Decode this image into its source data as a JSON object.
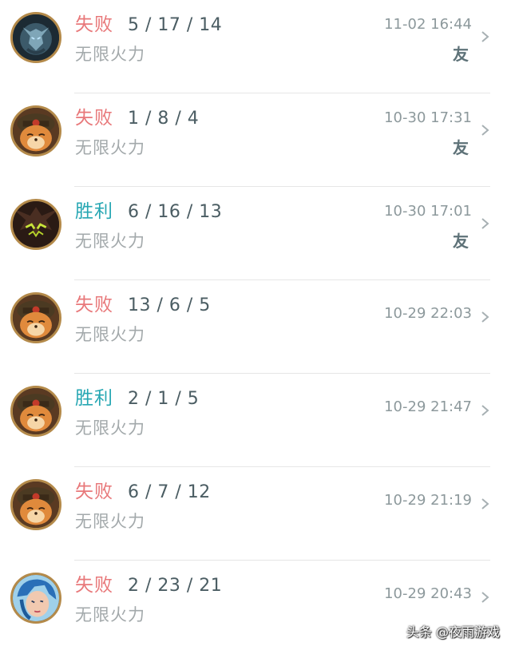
{
  "matches": [
    {
      "champion_icon": "dark-knight-champion-icon",
      "result": "失败",
      "outcome": "loss",
      "kda": "5 / 17 / 14",
      "mode": "无限火力",
      "time": "11-02 16:44",
      "badge": "友"
    },
    {
      "champion_icon": "teemo-champion-icon",
      "result": "失败",
      "outcome": "loss",
      "kda": "1 / 8 / 4",
      "mode": "无限火力",
      "time": "10-30 17:31",
      "badge": "友"
    },
    {
      "champion_icon": "shadow-beast-champion-icon",
      "result": "胜利",
      "outcome": "win",
      "kda": "6 / 16 / 13",
      "mode": "无限火力",
      "time": "10-30 17:01",
      "badge": "友"
    },
    {
      "champion_icon": "teemo-champion-icon",
      "result": "失败",
      "outcome": "loss",
      "kda": "13 / 6 / 5",
      "mode": "无限火力",
      "time": "10-29 22:03",
      "badge": ""
    },
    {
      "champion_icon": "teemo-champion-icon",
      "result": "胜利",
      "outcome": "win",
      "kda": "2 / 1 / 5",
      "mode": "无限火力",
      "time": "10-29 21:47",
      "badge": ""
    },
    {
      "champion_icon": "teemo-champion-icon",
      "result": "失败",
      "outcome": "loss",
      "kda": "6 / 7 / 12",
      "mode": "无限火力",
      "time": "10-29 21:19",
      "badge": ""
    },
    {
      "champion_icon": "blue-hair-champion-icon",
      "result": "失败",
      "outcome": "loss",
      "kda": "2 / 23 / 21",
      "mode": "无限火力",
      "time": "10-29 20:43",
      "badge": ""
    }
  ],
  "watermark": "头条 @夜雨游戏",
  "colors": {
    "loss": "#e8787a",
    "win": "#27a7b3",
    "kda": "#4b5d63",
    "mode": "#a3a9ab",
    "time": "#8d999c"
  }
}
